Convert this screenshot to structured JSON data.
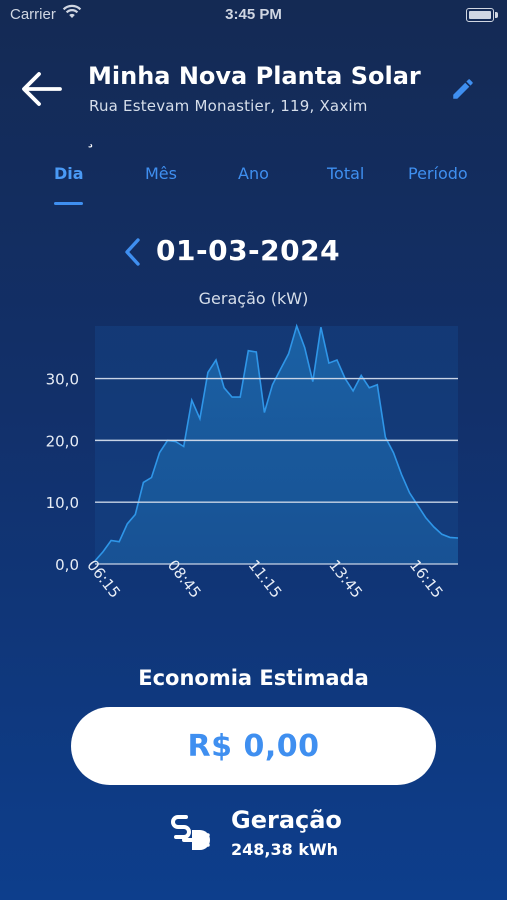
{
  "status_bar": {
    "carrier": "Carrier",
    "time": "3:45 PM"
  },
  "header": {
    "title": "Minha Nova Planta Solar",
    "address": "Rua Estevam Monastier, 119, Xaxim",
    "stray_mark": "¸"
  },
  "tabs": [
    {
      "label": "Dia",
      "active": true
    },
    {
      "label": "Mês",
      "active": false
    },
    {
      "label": "Ano",
      "active": false
    },
    {
      "label": "Total",
      "active": false
    },
    {
      "label": "Período",
      "active": false
    }
  ],
  "date_nav": {
    "date": "01-03-2024"
  },
  "chart_data": {
    "type": "area",
    "title": "Geração (kW)",
    "xlabel": "",
    "ylabel": "",
    "ylim": [
      0,
      38.5
    ],
    "y_ticks": [
      "0,0",
      "10,0",
      "20,0",
      "30,0"
    ],
    "x_ticks": [
      "06:15",
      "08:45",
      "11:15",
      "13:45",
      "16:15"
    ],
    "grid": true,
    "x": [
      "06:15",
      "06:30",
      "06:45",
      "07:00",
      "07:15",
      "07:30",
      "07:45",
      "08:00",
      "08:15",
      "08:30",
      "08:45",
      "09:00",
      "09:15",
      "09:30",
      "09:45",
      "10:00",
      "10:15",
      "10:30",
      "10:45",
      "11:00",
      "11:15",
      "11:30",
      "11:45",
      "12:00",
      "12:15",
      "12:30",
      "12:45",
      "13:00",
      "13:15",
      "13:30",
      "13:45",
      "14:00",
      "14:15",
      "14:30",
      "14:45",
      "15:00",
      "15:15",
      "15:30",
      "15:45",
      "16:00",
      "16:15",
      "16:30",
      "16:45",
      "17:00",
      "17:15",
      "17:30"
    ],
    "values": [
      0.5,
      2.0,
      3.8,
      3.6,
      6.5,
      8.0,
      13.2,
      14.0,
      18.0,
      20.0,
      19.8,
      19.0,
      26.5,
      23.5,
      31.0,
      33.0,
      28.5,
      27.0,
      27.0,
      34.5,
      34.3,
      24.5,
      29.0,
      31.5,
      34.0,
      38.5,
      35.0,
      29.5,
      38.3,
      32.5,
      33.0,
      30.0,
      28.0,
      30.5,
      28.5,
      29.0,
      20.5,
      18.0,
      14.5,
      11.5,
      9.5,
      7.5,
      6.0,
      4.8,
      4.3,
      4.2
    ]
  },
  "economy": {
    "title": "Economia Estimada",
    "value": "R$ 0,00"
  },
  "generation": {
    "label": "Geração",
    "value": "248,38 kWh"
  },
  "colors": {
    "accent": "#3f8ff0",
    "background_top": "#142a54",
    "background_bottom": "#0d3e8c",
    "area_fill": "#1b63a7",
    "area_line": "#2f96e8"
  }
}
